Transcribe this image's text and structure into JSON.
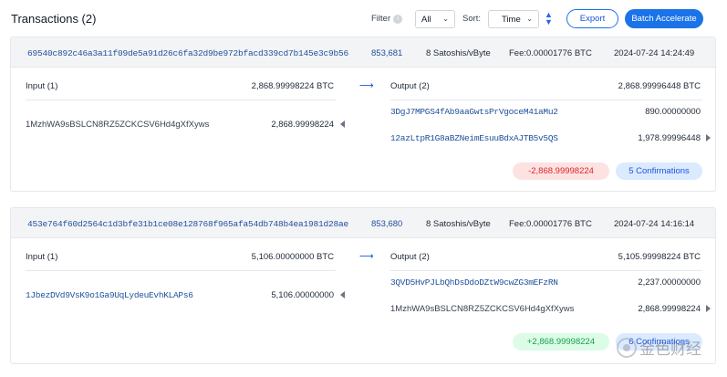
{
  "header": {
    "title": "Transactions (2)",
    "filter_label": "Filter",
    "filter_value": "All",
    "sort_label": "Sort:",
    "sort_value": "Time",
    "export_label": "Export",
    "batch_label": "Batch Accelerate"
  },
  "transactions": [
    {
      "txid": "69540c892c46a3a11f09de5a91d26c6fa32d9be972bfacd339cd7b145e3c9b56",
      "block": "853,681",
      "fee_rate": "8 Satoshis/vByte",
      "fee": "Fee:0.00001776 BTC",
      "time": "2024-07-24 14:24:49",
      "input_header": "Input (1)",
      "input_total": "2,868.99998224 BTC",
      "inputs": [
        {
          "address": "1MzhWA9sBSLCN8RZ5ZCKCSV6Hd4gXfXyws",
          "amount": "2,868.99998224"
        }
      ],
      "output_header": "Output (2)",
      "output_total": "2,868.99996448 BTC",
      "outputs": [
        {
          "address": "3DgJ7MPGS4fAb9aaGwtsPrVgoceM41aMu2",
          "amount": "890.00000000"
        },
        {
          "address": "12azLtpR1G8aBZNeimEsuuBdxAJTB5v5QS",
          "amount": "1,978.99996448"
        }
      ],
      "net_change": "-2,868.99998224",
      "confirmations": "5 Confirmations"
    },
    {
      "txid": "453e764f60d2564c1d3bfe31b1ce08e128768f965afa54db748b4ea1981d28ae",
      "block": "853,680",
      "fee_rate": "8 Satoshis/vByte",
      "fee": "Fee:0.00001776 BTC",
      "time": "2024-07-24 14:16:14",
      "input_header": "Input (1)",
      "input_total": "5,106.00000000 BTC",
      "inputs": [
        {
          "address": "1JbezDVd9VsK9o1Ga9UqLydeuEvhKLAPs6",
          "amount": "5,106.00000000"
        }
      ],
      "output_header": "Output (2)",
      "output_total": "5,105.99998224 BTC",
      "outputs": [
        {
          "address": "3QVD5HvPJLbQhDsDdoDZtW9cwZG3mEFzRN",
          "amount": "2,237.00000000"
        },
        {
          "address": "1MzhWA9sBSLCN8RZ5ZCKCSV6Hd4gXfXyws",
          "amount": "2,868.99998224"
        }
      ],
      "net_change": "+2,868.99998224",
      "confirmations": "6 Confirmations"
    }
  ],
  "watermark": {
    "text": "金色财经"
  },
  "colors": {
    "accent": "#1a73e8",
    "link": "#1e4f9c",
    "negative": "#dc2626",
    "positive": "#16a34a"
  }
}
